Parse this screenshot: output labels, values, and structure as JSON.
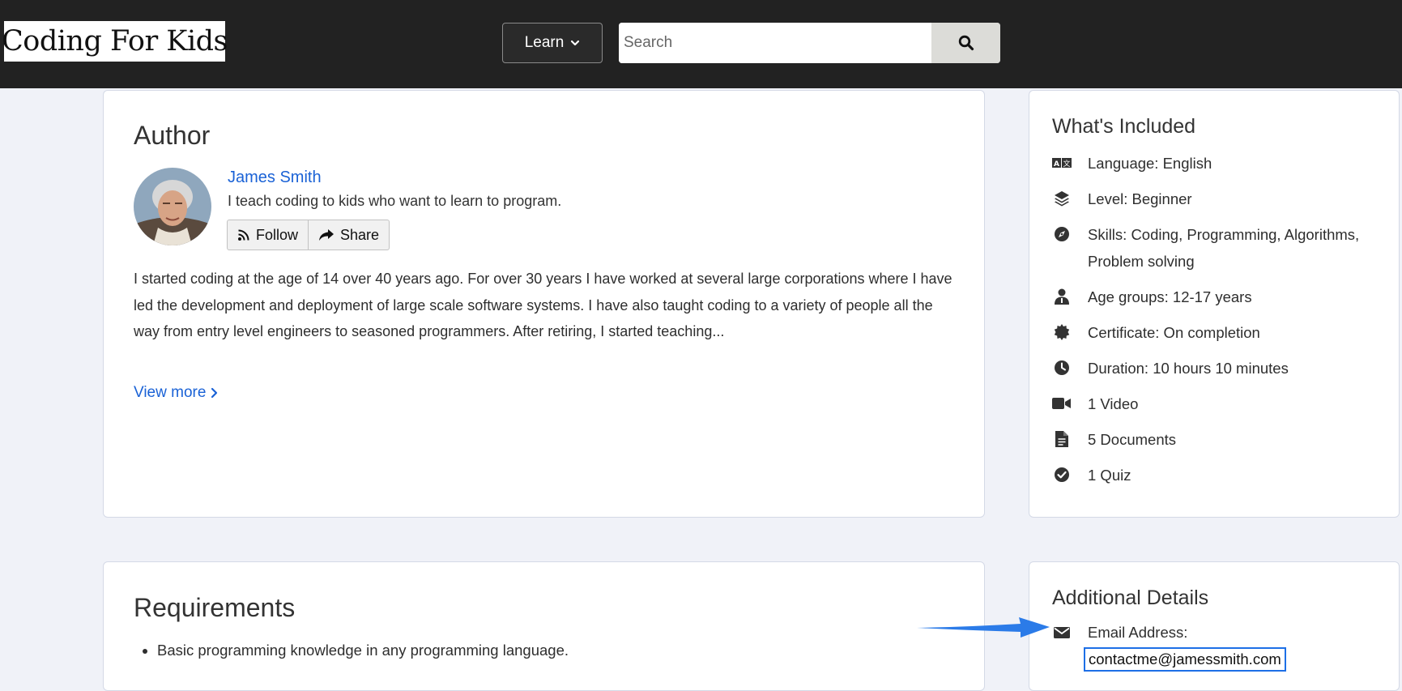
{
  "header": {
    "logo": "Coding For Kids",
    "learn_label": "Learn",
    "search_placeholder": "Search"
  },
  "author_card": {
    "heading": "Author",
    "name": "James Smith",
    "tagline": "I teach coding to kids who want to learn to program.",
    "follow_label": "Follow",
    "share_label": "Share",
    "bio": "I started coding at the age of 14 over 40 years ago. For over 30 years I have worked at several large corporations where I have led the development and deployment of large scale software systems. I have also taught coding to a variety of people all the way from entry level engineers to seasoned programmers.  After retiring, I started teaching...",
    "view_more": "View more"
  },
  "whats_included": {
    "heading": "What's Included",
    "items": [
      {
        "icon": "translate-icon",
        "text": "Language: English"
      },
      {
        "icon": "layers-icon",
        "text": "Level: Beginner"
      },
      {
        "icon": "compass-icon",
        "text": "Skills: Coding, Programming, Algorithms, Problem solving"
      },
      {
        "icon": "user-icon",
        "text": "Age groups: 12-17 years"
      },
      {
        "icon": "badge-icon",
        "text": "Certificate: On completion"
      },
      {
        "icon": "clock-icon",
        "text": "Duration: 10 hours 10 minutes"
      },
      {
        "icon": "video-icon",
        "text": "1 Video"
      },
      {
        "icon": "document-icon",
        "text": "5 Documents"
      },
      {
        "icon": "check-circle-icon",
        "text": "1 Quiz"
      }
    ]
  },
  "requirements": {
    "heading": "Requirements",
    "items": [
      "Basic programming knowledge in any programming language."
    ]
  },
  "additional_details": {
    "heading": "Additional Details",
    "email_label": "Email Address:",
    "email_value": "contactme@jamessmith.com"
  },
  "colors": {
    "topbar": "#222222",
    "link": "#1a62d6",
    "highlight": "#1d6fe6",
    "page_bg": "#f0f2f8"
  }
}
